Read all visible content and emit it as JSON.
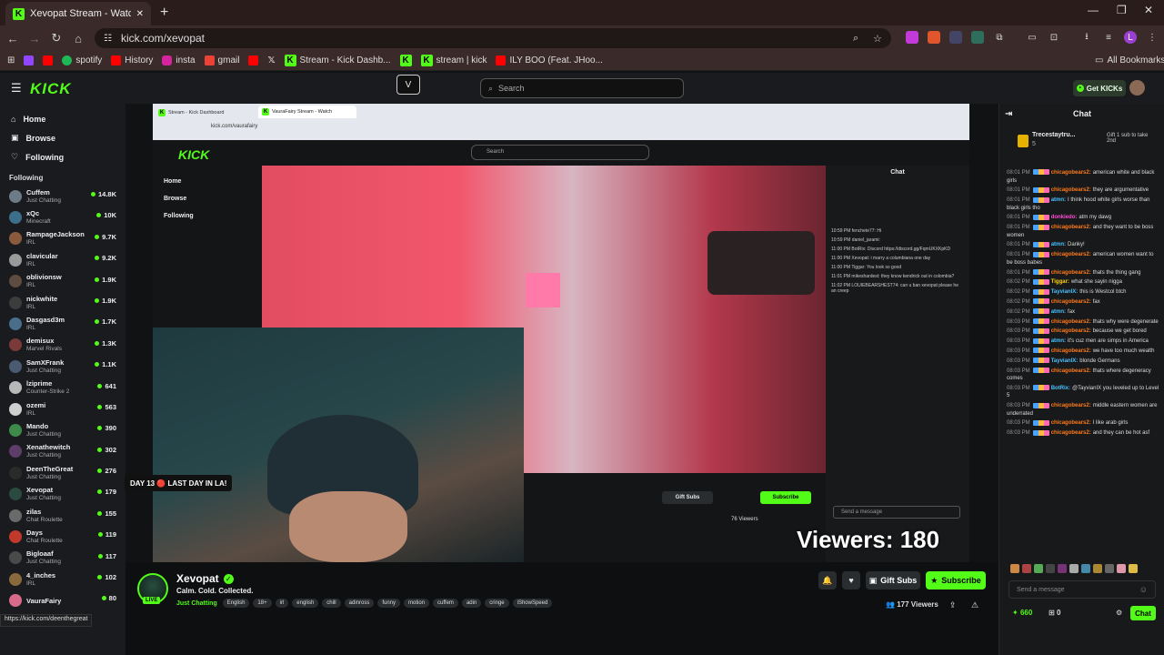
{
  "browser": {
    "tab_title": "Xevopat Stream - Watch Li",
    "url": "kick.com/xevopat",
    "bookmarks": [
      "spotify",
      "History",
      "insta",
      "gmail",
      "Stream - Kick Dashb...",
      "stream | kick",
      "ILY BOO (Feat. JHoo..."
    ],
    "all_bookmarks": "All Bookmarks",
    "profile_letter": "L"
  },
  "header": {
    "logo": "KICK",
    "search_placeholder": "Search",
    "get_kicks": "Get KICKs"
  },
  "sidebar": {
    "nav": [
      "Home",
      "Browse",
      "Following"
    ],
    "following_label": "Following",
    "channels": [
      {
        "name": "Cuffem",
        "category": "Just Chatting",
        "viewers": "14.8K",
        "color": "#6d7b86"
      },
      {
        "name": "xQc",
        "category": "Minecraft",
        "viewers": "10K",
        "color": "#3d6e8a"
      },
      {
        "name": "RampageJackson",
        "category": "IRL",
        "viewers": "9.7K",
        "color": "#8a5a3d"
      },
      {
        "name": "clavicular",
        "category": "IRL",
        "viewers": "9.2K",
        "color": "#9a9a9a"
      },
      {
        "name": "oblivionsw",
        "category": "IRL",
        "viewers": "1.9K",
        "color": "#5d4c3f"
      },
      {
        "name": "nickwhite",
        "category": "IRL",
        "viewers": "1.9K",
        "color": "#3c3c3c"
      },
      {
        "name": "Dasgasd3m",
        "category": "IRL",
        "viewers": "1.7K",
        "color": "#4a6d8a"
      },
      {
        "name": "demisux",
        "category": "Marvel Rivals",
        "viewers": "1.3K",
        "color": "#7a3a3a"
      },
      {
        "name": "SamXFrank",
        "category": "Just Chatting",
        "viewers": "1.1K",
        "color": "#4a5a70"
      },
      {
        "name": "lziprime",
        "category": "Counter-Strike 2",
        "viewers": "641",
        "color": "#b8b8b8"
      },
      {
        "name": "ozemi",
        "category": "IRL",
        "viewers": "563",
        "color": "#cfcfcf"
      },
      {
        "name": "Mando",
        "category": "Just Chatting",
        "viewers": "390",
        "color": "#3d8a4a"
      },
      {
        "name": "Xenathewitch",
        "category": "Just Chatting",
        "viewers": "302",
        "color": "#5d3d6a"
      },
      {
        "name": "DeenTheGreat",
        "category": "Just Chatting",
        "viewers": "276",
        "color": "#2a2a2a"
      },
      {
        "name": "Xevopat",
        "category": "Just Chatting",
        "viewers": "179",
        "color": "#2b4a3f"
      },
      {
        "name": "zilas",
        "category": "Chat Roulette",
        "viewers": "155",
        "color": "#6a6a6a"
      },
      {
        "name": "Days",
        "category": "Chat Roulette",
        "viewers": "119",
        "color": "#c0392b"
      },
      {
        "name": "Bigloaaf",
        "category": "Just Chatting",
        "viewers": "117",
        "color": "#4a4a4a"
      },
      {
        "name": "4_inches",
        "category": "IRL",
        "viewers": "102",
        "color": "#8a6a3d"
      },
      {
        "name": "VauraFairy",
        "category": "",
        "viewers": "80",
        "color": "#d86b8a"
      }
    ]
  },
  "video": {
    "inner_tabs": [
      "Stream - Kick Dashboard",
      "VauraFairy Stream - Watch"
    ],
    "inner_url": "kick.com/vaurafairy",
    "inner_chat_lines": [
      "10:59 PM fenchete77: Hi",
      "10:59 PM daniel_jarami:",
      "11:00 PM BotRix: Discord https://discord.gg/FqmUKXKpKD",
      "11:00 PM Xevopat: i marry a columbiana one day",
      "11:00 PM Tiggar: You look so good",
      "11:01 PM mikeshardest: they know kendrick out in colombia?",
      "11:02 PM LOUIEBEARSHEST74: can u ban xevopat please he an creep"
    ],
    "viewers_overlay": "Viewers: 180",
    "day_overlay": "DAY 13 🔴 LAST DAY IN LA!",
    "inner_viewers": "76 Viewers"
  },
  "stream": {
    "name": "Xevopat",
    "title": "Calm. Cold. Collected.",
    "live": "LIVE",
    "category": "Just Chatting",
    "tags": [
      "English",
      "18+",
      "irl",
      "english",
      "chill",
      "adinross",
      "funny",
      "motion",
      "cuffem",
      "adin",
      "cringe",
      "iShowSpeed"
    ],
    "gift_subs": "Gift Subs",
    "subscribe": "Subscribe",
    "viewers": "177 Viewers"
  },
  "chat": {
    "title": "Chat",
    "pinned_user": "Trecestaytru...",
    "pinned_text": "Gift 1 sub to take 2nd",
    "pinned_count": "5",
    "messages": [
      {
        "t": "08:01 PM",
        "u": "chicagobears2:",
        "m": "american white and black girls",
        "c": "#ff7a1a"
      },
      {
        "t": "08:01 PM",
        "u": "chicagobears2:",
        "m": "they are argumentative",
        "c": "#ff7a1a"
      },
      {
        "t": "08:01 PM",
        "u": "atmn:",
        "m": "I think hood white girls worse than black girls tho",
        "c": "#4ac1ff"
      },
      {
        "t": "08:01 PM",
        "u": "donkiedo:",
        "m": "atm my dawg",
        "c": "#ff4dd2"
      },
      {
        "t": "08:01 PM",
        "u": "chicagobears2:",
        "m": "and they want to be boss women",
        "c": "#ff7a1a"
      },
      {
        "t": "08:01 PM",
        "u": "atmn:",
        "m": "Danky!",
        "c": "#4ac1ff"
      },
      {
        "t": "08:01 PM",
        "u": "chicagobears2:",
        "m": "american women want to be boss babes",
        "c": "#ff7a1a"
      },
      {
        "t": "08:01 PM",
        "u": "chicagobears2:",
        "m": "thats the thing gang",
        "c": "#ff7a1a"
      },
      {
        "t": "08:02 PM",
        "u": "Tiggar:",
        "m": "what she sayin nigga",
        "c": "#ffd400"
      },
      {
        "t": "08:02 PM",
        "u": "TayvianIX:",
        "m": "this is Westcol btch",
        "c": "#4ac1ff"
      },
      {
        "t": "08:02 PM",
        "u": "chicagobears2:",
        "m": "fax",
        "c": "#ff7a1a"
      },
      {
        "t": "08:02 PM",
        "u": "atmn:",
        "m": "fax",
        "c": "#4ac1ff"
      },
      {
        "t": "08:03 PM",
        "u": "chicagobears2:",
        "m": "thats why were degenerate",
        "c": "#ff7a1a"
      },
      {
        "t": "08:03 PM",
        "u": "chicagobears2:",
        "m": "because we get bored",
        "c": "#ff7a1a"
      },
      {
        "t": "08:03 PM",
        "u": "atmn:",
        "m": "it's cuz men are simps in America",
        "c": "#4ac1ff"
      },
      {
        "t": "08:03 PM",
        "u": "chicagobears2:",
        "m": "we have too much wealth",
        "c": "#ff7a1a"
      },
      {
        "t": "08:03 PM",
        "u": "TayvianIX:",
        "m": "blonde Germans",
        "c": "#4ac1ff"
      },
      {
        "t": "08:03 PM",
        "u": "chicagobears2:",
        "m": "thats where degeneracy comes",
        "c": "#ff7a1a"
      },
      {
        "t": "08:03 PM",
        "u": "BotRix:",
        "m": "@TayvianIX you leveled up to Level 5",
        "c": "#4ac1ff"
      },
      {
        "t": "08:03 PM",
        "u": "chicagobears2:",
        "m": "middle eastern women are underrated",
        "c": "#ff7a1a"
      },
      {
        "t": "08:03 PM",
        "u": "chicagobears2:",
        "m": "I like arab girls",
        "c": "#ff7a1a"
      },
      {
        "t": "08:03 PM",
        "u": "chicagobears2:",
        "m": "and they can be hot asf",
        "c": "#ff7a1a"
      }
    ],
    "input_placeholder": "Send a message",
    "kicks": "660",
    "zero": "0",
    "chat_button": "Chat"
  },
  "status_url": "https://kick.com/deenthegreat"
}
